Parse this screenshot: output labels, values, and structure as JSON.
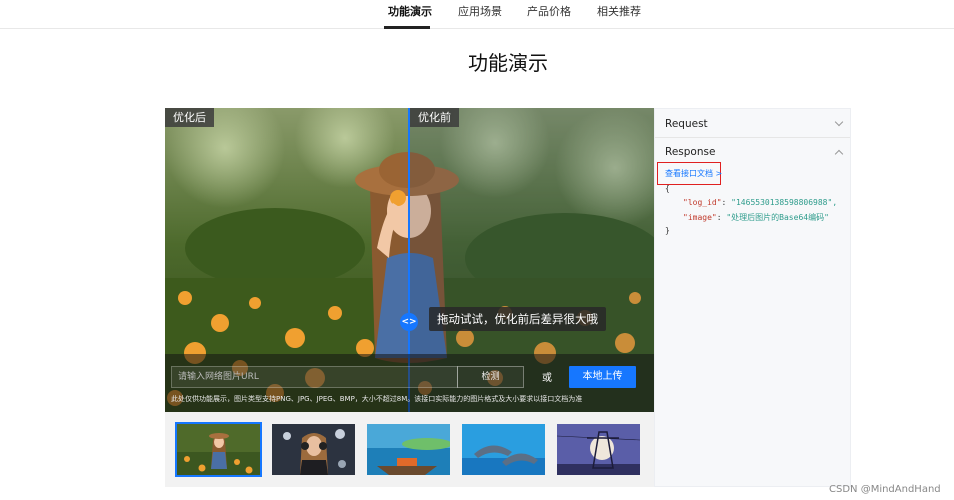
{
  "nav": {
    "tabs": [
      {
        "label": "功能演示",
        "active": true
      },
      {
        "label": "应用场景",
        "active": false
      },
      {
        "label": "产品价格",
        "active": false
      },
      {
        "label": "相关推荐",
        "active": false
      }
    ]
  },
  "page_title": "功能演示",
  "demo": {
    "tag_after": "优化后",
    "tag_before": "优化前",
    "handle_glyph": "<>",
    "hint": "拖动试试，优化前后差异很大哦",
    "url_placeholder": "请输入网络图片URL",
    "detect_label": "检测",
    "or_label": "或",
    "upload_label": "本地上传",
    "notice": "此处仅供功能展示，图片类型支持PNG、JPG、JPEG、BMP，大小不超过8M。该接口实际能力的图片格式及大小要求以接口文档为准"
  },
  "thumbnails": [
    {
      "name": "girl-flowers",
      "active": true
    },
    {
      "name": "girl-headphones",
      "active": false
    },
    {
      "name": "boat",
      "active": false
    },
    {
      "name": "dolphins",
      "active": false
    },
    {
      "name": "power-tower",
      "active": false
    }
  ],
  "panel": {
    "request_label": "Request",
    "response_label": "Response",
    "doc_link": "查看接口文档 >",
    "code": {
      "open": "{",
      "log_id_key": "\"log_id\"",
      "log_id_val": "\"1465530138598806988\",",
      "image_key": "\"image\"",
      "image_val": "\"处理后图片的Base64编码\"",
      "close": "}"
    }
  },
  "watermark": "CSDN @MindAndHand",
  "colors": {
    "accent": "#1677ff",
    "highlight_box": "#e02020"
  }
}
